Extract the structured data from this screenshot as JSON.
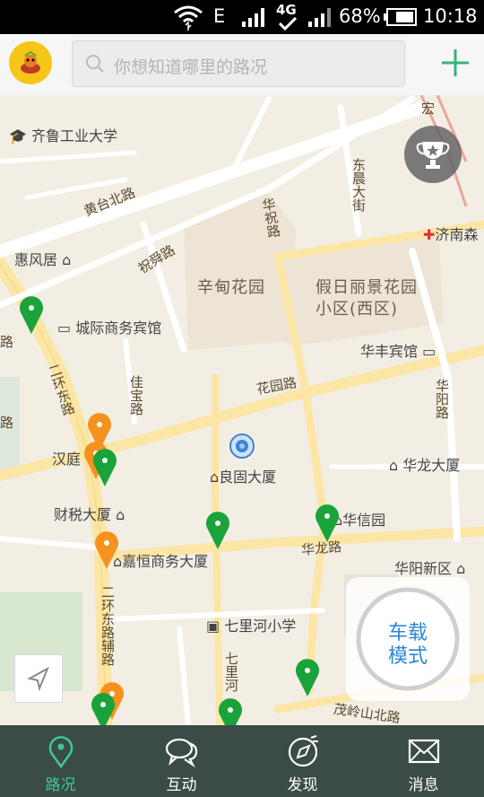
{
  "status_bar": {
    "network": "E",
    "network2": "4G",
    "battery": "68%",
    "time": "10:18"
  },
  "search": {
    "placeholder": "你想知道哪里的路况"
  },
  "map": {
    "areas": [
      {
        "text": "辛甸花园"
      },
      {
        "text": "假日丽景花园"
      },
      {
        "text": "小区(西区)"
      }
    ],
    "pois": [
      {
        "text": "齐鲁工业大学"
      },
      {
        "text": "惠风居"
      },
      {
        "text": "城际商务宾馆"
      },
      {
        "text": "济南森"
      },
      {
        "text": "华丰宾馆"
      },
      {
        "text": "汉庭"
      },
      {
        "text": "良固大厦"
      },
      {
        "text": "华龙大厦"
      },
      {
        "text": "财税大厦"
      },
      {
        "text": "华信园"
      },
      {
        "text": "嘉恒商务大厦"
      },
      {
        "text": "华阳新区"
      },
      {
        "text": "七里河小学"
      }
    ],
    "roads": [
      {
        "text": "黄台北路"
      },
      {
        "text": "祝舜路"
      },
      {
        "text": "华祝路"
      },
      {
        "text": "东晨大街"
      },
      {
        "text": "花园路"
      },
      {
        "text": "华阳路"
      },
      {
        "text": "二环东路"
      },
      {
        "text": "佳宝路"
      },
      {
        "text": "华龙路"
      },
      {
        "text": "二环东路辅路"
      },
      {
        "text": "七里河"
      },
      {
        "text": "茂岭山北路"
      },
      {
        "text": "路"
      },
      {
        "text": "路"
      },
      {
        "text": "宏"
      }
    ]
  },
  "car_mode": {
    "line1": "车载",
    "line2": "模式"
  },
  "nav": [
    {
      "label": "路况",
      "icon": "location-pin-icon",
      "active": true
    },
    {
      "label": "互动",
      "icon": "chat-bubbles-icon",
      "active": false
    },
    {
      "label": "发现",
      "icon": "discover-icon",
      "active": false
    },
    {
      "label": "消息",
      "icon": "mail-icon",
      "active": false
    }
  ],
  "colors": {
    "active_nav": "#3cc8a0",
    "pin_green": "#1aa33a",
    "pin_orange": "#f5921e",
    "car_text": "#2f86d6"
  }
}
